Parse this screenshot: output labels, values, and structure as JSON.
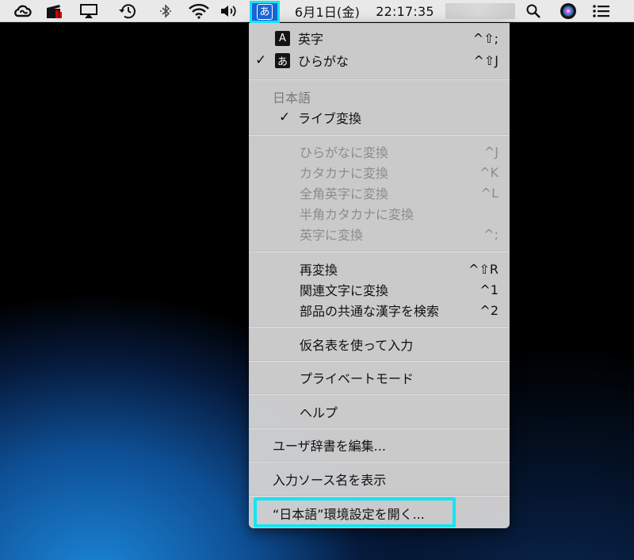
{
  "menubar": {
    "date": "6月1日(金)",
    "time": "22:17:35",
    "ime_glyph": "あ",
    "icons": [
      "creative-cloud-icon",
      "clapper-icon",
      "airplay-icon",
      "time-machine-icon",
      "bluetooth-icon",
      "wifi-icon",
      "volume-icon",
      "spotlight-icon",
      "siri-icon",
      "notification-center-icon"
    ]
  },
  "menu": {
    "input_sources": [
      {
        "badge": "A",
        "label": "英字",
        "shortcut": "^⇧;",
        "checked": false
      },
      {
        "badge": "あ",
        "label": "ひらがな",
        "shortcut": "^⇧J",
        "checked": true
      }
    ],
    "section_header": "日本語",
    "live_conversion": {
      "label": "ライブ変換",
      "checked": true
    },
    "convert_items": [
      {
        "label": "ひらがなに変換",
        "shortcut": "^J"
      },
      {
        "label": "カタカナに変換",
        "shortcut": "^K"
      },
      {
        "label": "全角英字に変換",
        "shortcut": "^L"
      },
      {
        "label": "半角カタカナに変換",
        "shortcut": ""
      },
      {
        "label": "英字に変換",
        "shortcut": "^;"
      }
    ],
    "reconvert_items": [
      {
        "label": "再変換",
        "shortcut": "^⇧R"
      },
      {
        "label": "関連文字に変換",
        "shortcut": "^1"
      },
      {
        "label": "部品の共通な漢字を検索",
        "shortcut": "^2"
      }
    ],
    "kana_table": "仮名表を使って入力",
    "private_mode": "プライベートモード",
    "help": "ヘルプ",
    "edit_dictionary": "ユーザ辞書を編集...",
    "show_source_name": "入力ソース名を表示",
    "open_preferences": "“日本語”環境設定を開く..."
  }
}
